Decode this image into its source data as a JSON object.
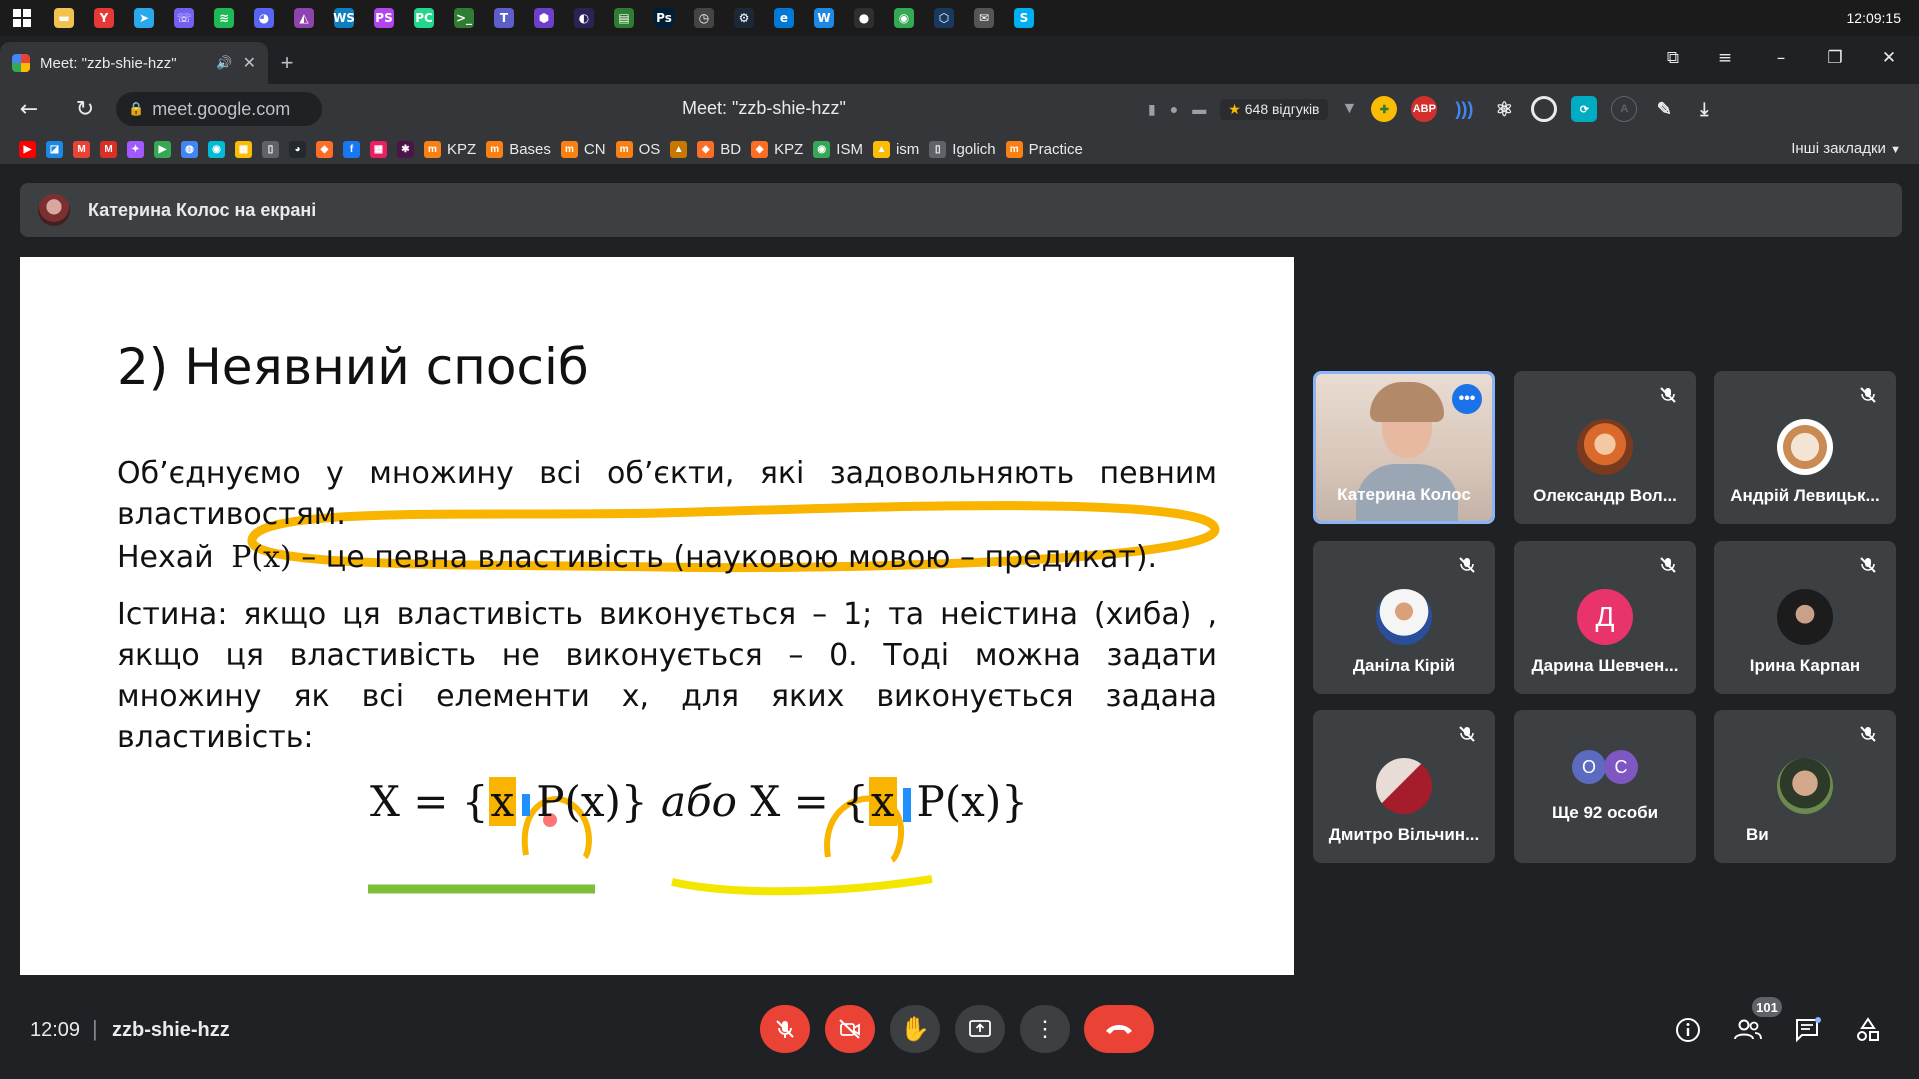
{
  "taskbar": {
    "clock": "12:09:15",
    "apps": [
      {
        "icon": "file-explorer-icon",
        "color": "#f0c34c",
        "glyph": "▬"
      },
      {
        "icon": "yandex-browser-icon",
        "color": "#e53935",
        "glyph": "Y"
      },
      {
        "icon": "telegram-icon",
        "color": "#29a9eb",
        "glyph": "➤"
      },
      {
        "icon": "viber-icon",
        "color": "#7360f2",
        "glyph": "☏"
      },
      {
        "icon": "spotify-icon",
        "color": "#1db954",
        "glyph": "≋"
      },
      {
        "icon": "discord-icon",
        "color": "#5865f2",
        "glyph": "◕"
      },
      {
        "icon": "visual-studio-icon",
        "color": "#8e44ad",
        "glyph": "◭"
      },
      {
        "icon": "webstorm-icon",
        "color": "#0e7fc0",
        "glyph": "WS"
      },
      {
        "icon": "phpstorm-icon",
        "color": "#b345f1",
        "glyph": "PS"
      },
      {
        "icon": "pycharm-icon",
        "color": "#21d789",
        "glyph": "PC"
      },
      {
        "icon": "terminal-icon",
        "color": "#2e7d32",
        "glyph": ">_"
      },
      {
        "icon": "teams-icon",
        "color": "#5b5fc7",
        "glyph": "T"
      },
      {
        "icon": "github-desktop-icon",
        "color": "#6e40c9",
        "glyph": "⬢"
      },
      {
        "icon": "eclipse-icon",
        "color": "#2c2255",
        "glyph": "◐"
      },
      {
        "icon": "notepad-icon",
        "color": "#2e7d32",
        "glyph": "▤"
      },
      {
        "icon": "photoshop-icon",
        "color": "#001e36",
        "glyph": "Ps"
      },
      {
        "icon": "speedometer-icon",
        "color": "#444",
        "glyph": "◷"
      },
      {
        "icon": "steam-icon",
        "color": "#1b2838",
        "glyph": "⚙"
      },
      {
        "icon": "edge-icon",
        "color": "#0078d4",
        "glyph": "e"
      },
      {
        "icon": "word-pad-icon",
        "color": "#1e88e5",
        "glyph": "W"
      },
      {
        "icon": "obs-icon",
        "color": "#302e31",
        "glyph": "●"
      },
      {
        "icon": "chrome-icon",
        "color": "#34a853",
        "glyph": "◉"
      },
      {
        "icon": "virtualbox-icon",
        "color": "#183a61",
        "glyph": "⬡"
      },
      {
        "icon": "mail-icon",
        "color": "#555",
        "glyph": "✉"
      },
      {
        "icon": "skype-icon",
        "color": "#00aff0",
        "glyph": "S"
      }
    ]
  },
  "browser": {
    "tab_title": "Meet: \"zzb-shie-hzz\"",
    "tab_audio": "🔊",
    "tab_close": "✕",
    "new_tab": "+",
    "url": "meet.google.com",
    "page_title": "Meet: \"zzb-shie-hzz\"",
    "reviews_label": "648 відгуків",
    "reviews_star": "★",
    "bookmarks": [
      {
        "label": "",
        "icon": "youtube-icon",
        "color": "#ff0000",
        "glyph": "▶"
      },
      {
        "label": "",
        "icon": "classroom-icon",
        "color": "#1e88e5",
        "glyph": "◪"
      },
      {
        "label": "",
        "icon": "gmail-icon",
        "color": "#ea4335",
        "glyph": "M"
      },
      {
        "label": "",
        "icon": "gmail-alt-icon",
        "color": "#d93025",
        "glyph": "M"
      },
      {
        "label": "",
        "icon": "figma-icon",
        "color": "#a259ff",
        "glyph": "✦"
      },
      {
        "label": "",
        "icon": "play-store-icon",
        "color": "#34a853",
        "glyph": "▶"
      },
      {
        "label": "",
        "icon": "globe-icon",
        "color": "#4285f4",
        "glyph": "◍"
      },
      {
        "label": "",
        "icon": "circle-play-icon",
        "color": "#00bcd4",
        "glyph": "◉"
      },
      {
        "label": "",
        "icon": "grid-app-icon",
        "color": "#fbbc04",
        "glyph": "▦"
      },
      {
        "label": "",
        "icon": "blank-page-icon",
        "color": "#5f6368",
        "glyph": "▯"
      },
      {
        "label": "",
        "icon": "github-icon",
        "color": "#24292e",
        "glyph": "◕"
      },
      {
        "label": "",
        "icon": "gitlab-icon",
        "color": "#fc6d26",
        "glyph": "◆"
      },
      {
        "label": "",
        "icon": "facebook-icon",
        "color": "#1877f2",
        "glyph": "f"
      },
      {
        "label": "",
        "icon": "colorful-grid-icon",
        "color": "#e91e63",
        "glyph": "▦"
      },
      {
        "label": "",
        "icon": "slack-icon",
        "color": "#4a154b",
        "glyph": "✱"
      },
      {
        "label": "KPZ",
        "icon": "moodle-icon",
        "color": "#f98012",
        "glyph": "m"
      },
      {
        "label": "Bases",
        "icon": "moodle-icon",
        "color": "#f98012",
        "glyph": "m"
      },
      {
        "label": "CN",
        "icon": "moodle-icon",
        "color": "#f98012",
        "glyph": "m"
      },
      {
        "label": "OS",
        "icon": "moodle-icon",
        "color": "#f98012",
        "glyph": "m"
      },
      {
        "label": "",
        "icon": "university-icon",
        "color": "#c77800",
        "glyph": "▲"
      },
      {
        "label": "BD",
        "icon": "gitlab-icon",
        "color": "#fc6d26",
        "glyph": "◆"
      },
      {
        "label": "KPZ",
        "icon": "gitlab-icon",
        "color": "#fc6d26",
        "glyph": "◆"
      },
      {
        "label": "ISM",
        "icon": "chrome-app-icon",
        "color": "#34a853",
        "glyph": "◉"
      },
      {
        "label": "ism",
        "icon": "google-drive-icon",
        "color": "#fbbc04",
        "glyph": "▲"
      },
      {
        "label": "Igolich",
        "icon": "blank-page-icon",
        "color": "#5f6368",
        "glyph": "▯"
      },
      {
        "label": "Practice",
        "icon": "moodle-icon",
        "color": "#f98012",
        "glyph": "m"
      }
    ],
    "other_bookmarks": "Інші закладки"
  },
  "meet": {
    "presenter_label": "Катерина Колос на екрані",
    "slide": {
      "heading": "2) Неявний спосіб",
      "para1": "Об’єднуємо у множину всі об’єкти, які задовольняють певним властивостям.",
      "para2_prefix": "Нехай ",
      "para2_math": "P(x)",
      "para2_suffix": " – це певна властивість (науковою мовою – предикат).",
      "para3": "Істина: якщо ця властивість виконується – 1; та неістина (хиба) , якщо ця властивість не виконується – 0. Тоді можна задати множину як всі елементи x, для яких виконується задана властивість:",
      "formula_left_X": "X = {",
      "formula_x": "x",
      "formula_mid": "P(x)}",
      "formula_or": " або ",
      "formula_right_X": "X = {",
      "formula_x2": "x",
      "formula_mid2": "P(x)}"
    },
    "participants": [
      {
        "name": "Катерина Колос",
        "muted": false,
        "active": true
      },
      {
        "name": "Олександр Вол...",
        "muted": true
      },
      {
        "name": "Андрій Левицьк...",
        "muted": true
      },
      {
        "name": "Даніла Кірій",
        "muted": true
      },
      {
        "name": "Дарина Шевчен...",
        "muted": true,
        "initial": "Д",
        "color": "#e8336b"
      },
      {
        "name": "Ірина Карпан",
        "muted": true
      },
      {
        "name": "Дмитро Вільчин...",
        "muted": true
      },
      {
        "name": "Ще 92 особи",
        "initials": [
          "О",
          "С"
        ],
        "colors": [
          "#5c6bc0",
          "#7e57c2"
        ]
      },
      {
        "name": "Ви",
        "muted": true
      }
    ],
    "bottom": {
      "time": "12:09",
      "separator": "|",
      "code": "zzb-shie-hzz",
      "people_count": "101"
    }
  }
}
